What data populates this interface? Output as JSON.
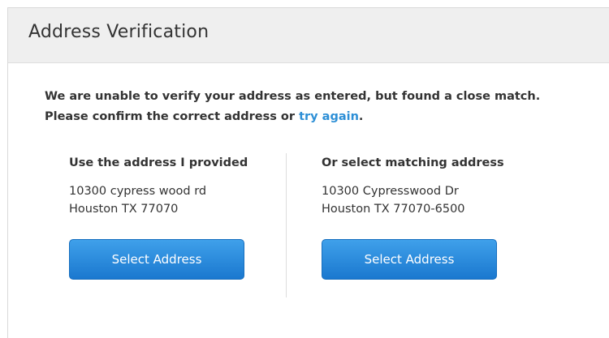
{
  "dialog": {
    "title": "Address Verification"
  },
  "message": {
    "line1": "We are unable to verify your address as entered, but found a close match.",
    "line2_prefix": "Please confirm the correct address or ",
    "link_label": "try again",
    "line2_suffix": "."
  },
  "provided": {
    "heading": "Use the address I provided",
    "street": "10300 cypress wood rd",
    "city_line": "Houston TX 77070",
    "button_label": "Select Address"
  },
  "matching": {
    "heading": "Or select matching address",
    "street": "10300 Cypresswood Dr",
    "city_line": "Houston TX 77070-6500",
    "button_label": "Select Address"
  },
  "colors": {
    "link": "#2d8fd6",
    "button": "#1a78cf",
    "header_bg": "#efefef"
  }
}
